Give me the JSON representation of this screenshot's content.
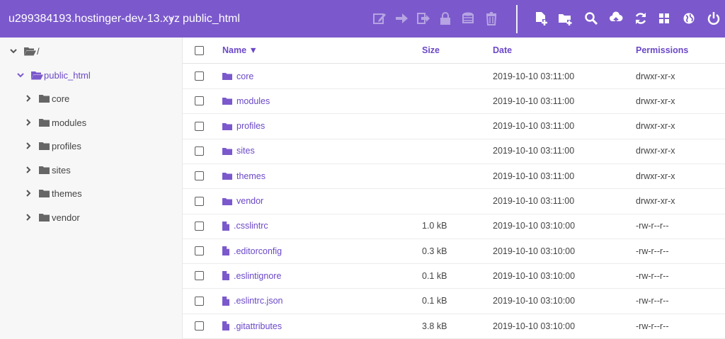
{
  "header": {
    "host": "u299384193.hostinger-dev-13.xyz",
    "separator": "›",
    "current_dir": "public_html"
  },
  "toolbar": {
    "actions_dim": [
      "edit-icon",
      "move-icon",
      "rename-icon",
      "permissions-icon",
      "archive-icon",
      "delete-icon"
    ],
    "actions": [
      "new-file-icon",
      "new-folder-icon",
      "search-icon",
      "upload-icon",
      "refresh-icon",
      "grid-icon",
      "globe-icon",
      "power-icon"
    ]
  },
  "tree": {
    "root": "/",
    "current": "public_html",
    "children": [
      "core",
      "modules",
      "profiles",
      "sites",
      "themes",
      "vendor"
    ]
  },
  "table": {
    "headers": {
      "name": "Name ▼",
      "size": "Size",
      "date": "Date",
      "permissions": "Permissions"
    },
    "rows": [
      {
        "type": "folder",
        "name": "core",
        "size": "",
        "date": "2019-10-10 03:11:00",
        "perm": "drwxr-xr-x"
      },
      {
        "type": "folder",
        "name": "modules",
        "size": "",
        "date": "2019-10-10 03:11:00",
        "perm": "drwxr-xr-x"
      },
      {
        "type": "folder",
        "name": "profiles",
        "size": "",
        "date": "2019-10-10 03:11:00",
        "perm": "drwxr-xr-x"
      },
      {
        "type": "folder",
        "name": "sites",
        "size": "",
        "date": "2019-10-10 03:11:00",
        "perm": "drwxr-xr-x"
      },
      {
        "type": "folder",
        "name": "themes",
        "size": "",
        "date": "2019-10-10 03:11:00",
        "perm": "drwxr-xr-x"
      },
      {
        "type": "folder",
        "name": "vendor",
        "size": "",
        "date": "2019-10-10 03:11:00",
        "perm": "drwxr-xr-x"
      },
      {
        "type": "file",
        "name": ".csslintrc",
        "size": "1.0 kB",
        "date": "2019-10-10 03:10:00",
        "perm": "-rw-r--r--"
      },
      {
        "type": "file",
        "name": ".editorconfig",
        "size": "0.3 kB",
        "date": "2019-10-10 03:10:00",
        "perm": "-rw-r--r--"
      },
      {
        "type": "file",
        "name": ".eslintignore",
        "size": "0.1 kB",
        "date": "2019-10-10 03:10:00",
        "perm": "-rw-r--r--"
      },
      {
        "type": "file",
        "name": ".eslintrc.json",
        "size": "0.1 kB",
        "date": "2019-10-10 03:10:00",
        "perm": "-rw-r--r--"
      },
      {
        "type": "file",
        "name": ".gitattributes",
        "size": "3.8 kB",
        "date": "2019-10-10 03:10:00",
        "perm": "-rw-r--r--"
      }
    ]
  },
  "colors": {
    "accent": "#7b59cc",
    "link": "#6b48c8",
    "icon_gray": "#777777"
  }
}
